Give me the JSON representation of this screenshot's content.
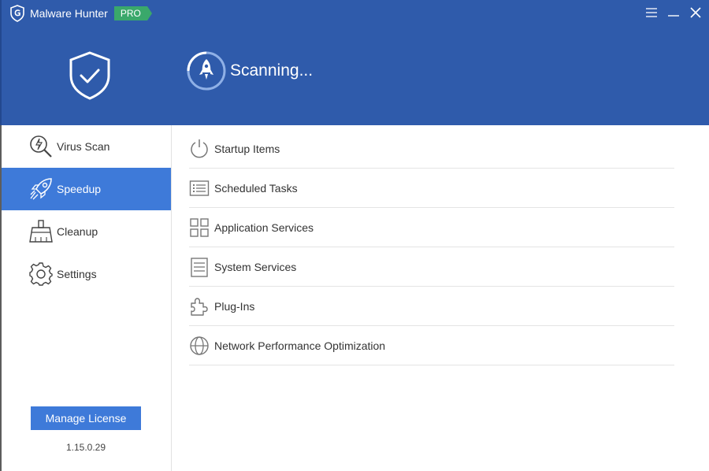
{
  "app": {
    "title": "Malware Hunter",
    "badge": "PRO"
  },
  "header": {
    "status_text": "Scanning..."
  },
  "sidebar": {
    "items": [
      {
        "label": "Virus Scan",
        "icon": "magnifier-bolt-icon",
        "active": false
      },
      {
        "label": "Speedup",
        "icon": "rocket-icon",
        "active": true
      },
      {
        "label": "Cleanup",
        "icon": "broom-icon",
        "active": false
      },
      {
        "label": "Settings",
        "icon": "gear-icon",
        "active": false
      }
    ],
    "license_button": "Manage License",
    "version": "1.15.0.29"
  },
  "main": {
    "items": [
      {
        "label": "Startup Items",
        "icon": "power-icon"
      },
      {
        "label": "Scheduled Tasks",
        "icon": "task-list-icon"
      },
      {
        "label": "Application Services",
        "icon": "grid-icon"
      },
      {
        "label": "System Services",
        "icon": "document-lines-icon"
      },
      {
        "label": "Plug-Ins",
        "icon": "puzzle-icon"
      },
      {
        "label": "Network Performance Optimization",
        "icon": "globe-icon"
      }
    ]
  },
  "colors": {
    "header_bg": "#2f5bab",
    "accent": "#3e7ad9",
    "badge": "#3aa86b"
  }
}
